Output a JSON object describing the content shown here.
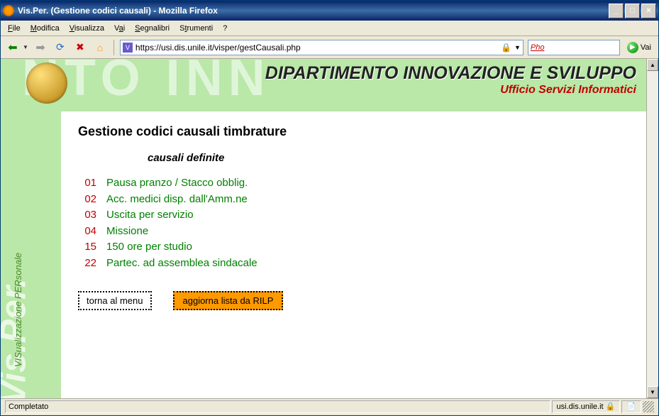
{
  "window": {
    "title": "Vis.Per. (Gestione codici causali) - Mozilla Firefox",
    "minimize": "_",
    "maximize": "□",
    "close": "×"
  },
  "menu": {
    "file": "File",
    "modifica": "Modifica",
    "visualizza": "Visualizza",
    "vai": "Vai",
    "segnalibri": "Segnalibri",
    "strumenti": "Strumenti",
    "help": "?"
  },
  "toolbar": {
    "url": "https://usi.dis.unile.it/visper/gestCausali.php",
    "search_placeholder": "Pho",
    "go_label": "Vai"
  },
  "header": {
    "dept": "DIPARTIMENTO INNOVAZIONE E SVILUPPO",
    "sub": "Ufficio Servizi Informatici",
    "ghost": "NTO INN"
  },
  "rail": {
    "logo": "Vis.Per.",
    "sub": "VISualizzazione PERsonale"
  },
  "page": {
    "title": "Gestione codici causali timbrature",
    "subhead": "causali definite",
    "back_btn": "torna al menu",
    "update_btn": "aggiorna lista da RILP"
  },
  "causali": [
    {
      "code": "01",
      "desc": "Pausa pranzo / Stacco obblig."
    },
    {
      "code": "02",
      "desc": "Acc. medici disp. dall'Amm.ne"
    },
    {
      "code": "03",
      "desc": "Uscita per servizio"
    },
    {
      "code": "04",
      "desc": "Missione"
    },
    {
      "code": "15",
      "desc": "150 ore per studio"
    },
    {
      "code": "22",
      "desc": "Partec. ad assemblea sindacale"
    }
  ],
  "status": {
    "left": "Completato",
    "domain": "usi.dis.unile.it"
  }
}
